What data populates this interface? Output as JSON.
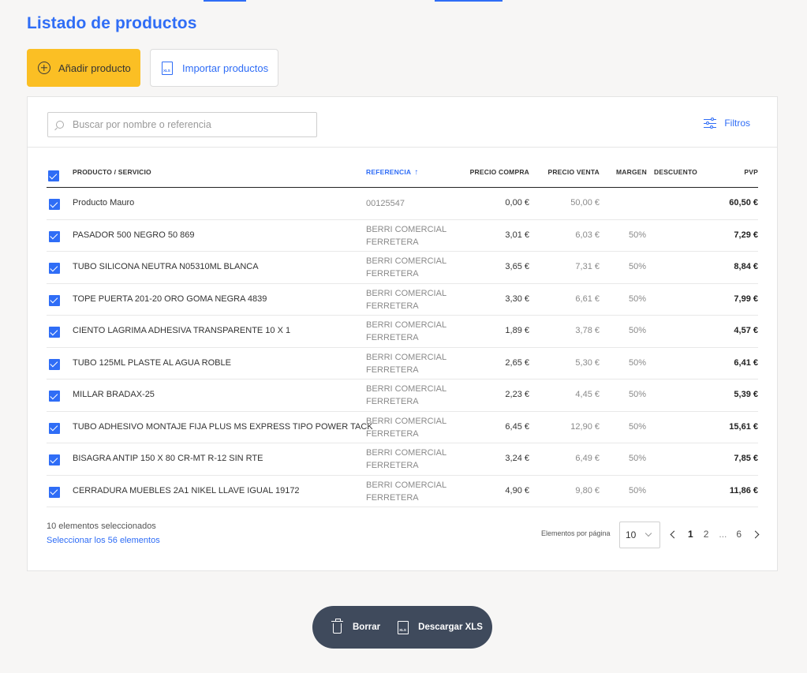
{
  "page": {
    "title": "Listado de productos",
    "accent_color": "#2f6df6"
  },
  "actions": {
    "add_label": "Añadir producto",
    "add_icon": "plus-circle-icon",
    "add_color": "#fbbf24",
    "import_label": "Importar productos",
    "import_icon": "xls-file-icon"
  },
  "search": {
    "placeholder": "Buscar por nombre o referencia",
    "value": "",
    "icon": "search-icon"
  },
  "filters": {
    "label": "Filtros",
    "icon": "sliders-icon"
  },
  "table": {
    "headers": {
      "product": "PRODUCTO / SERVICIO",
      "reference": "REFERENCIA",
      "buy_price": "PRECIO COMPRA",
      "sell_price": "PRECIO VENTA",
      "margin": "MARGEN",
      "discount": "DESCUENTO",
      "pvp": "PVP"
    },
    "sort": {
      "column": "reference",
      "direction": "ascending"
    },
    "all_checked": true,
    "rows": [
      {
        "checked": true,
        "name": "Producto Mauro",
        "ref": "00125547",
        "buy": "0,00 €",
        "sell": "50,00 €",
        "margin": "",
        "discount": "",
        "pvp": "60,50 €"
      },
      {
        "checked": true,
        "name": "PASADOR 500 NEGRO 50 869",
        "ref": "BERRI COMERCIAL FERRETERA",
        "buy": "3,01 €",
        "sell": "6,03 €",
        "margin": "50%",
        "discount": "",
        "pvp": "7,29 €"
      },
      {
        "checked": true,
        "name": "TUBO SILICONA NEUTRA N05310ML BLANCA",
        "ref": "BERRI COMERCIAL FERRETERA",
        "buy": "3,65 €",
        "sell": "7,31 €",
        "margin": "50%",
        "discount": "",
        "pvp": "8,84 €"
      },
      {
        "checked": true,
        "name": "TOPE PUERTA 201-20 ORO GOMA NEGRA 4839",
        "ref": "BERRI COMERCIAL FERRETERA",
        "buy": "3,30 €",
        "sell": "6,61 €",
        "margin": "50%",
        "discount": "",
        "pvp": "7,99 €"
      },
      {
        "checked": true,
        "name": "CIENTO LAGRIMA ADHESIVA TRANSPARENTE 10 X 1",
        "ref": "BERRI COMERCIAL FERRETERA",
        "buy": "1,89 €",
        "sell": "3,78 €",
        "margin": "50%",
        "discount": "",
        "pvp": "4,57 €"
      },
      {
        "checked": true,
        "name": "TUBO 125ML PLASTE AL AGUA ROBLE",
        "ref": "BERRI COMERCIAL FERRETERA",
        "buy": "2,65 €",
        "sell": "5,30 €",
        "margin": "50%",
        "discount": "",
        "pvp": "6,41 €"
      },
      {
        "checked": true,
        "name": "MILLAR BRADAX-25",
        "ref": "BERRI COMERCIAL FERRETERA",
        "buy": "2,23 €",
        "sell": "4,45 €",
        "margin": "50%",
        "discount": "",
        "pvp": "5,39 €"
      },
      {
        "checked": true,
        "name": "TUBO ADHESIVO MONTAJE FIJA PLUS MS EXPRESS TIPO POWER TACK",
        "ref": "BERRI COMERCIAL FERRETERA",
        "buy": "6,45 €",
        "sell": "12,90 €",
        "margin": "50%",
        "discount": "",
        "pvp": "15,61 €"
      },
      {
        "checked": true,
        "name": "BISAGRA ANTIP 150 X 80 CR-MT R-12 SIN RTE",
        "ref": "BERRI COMERCIAL FERRETERA",
        "buy": "3,24 €",
        "sell": "6,49 €",
        "margin": "50%",
        "discount": "",
        "pvp": "7,85 €"
      },
      {
        "checked": true,
        "name": "CERRADURA MUEBLES 2A1 NIKEL LLAVE IGUAL 19172",
        "ref": "BERRI COMERCIAL FERRETERA",
        "buy": "4,90 €",
        "sell": "9,80 €",
        "margin": "50%",
        "discount": "",
        "pvp": "11,86 €"
      }
    ]
  },
  "footer": {
    "selected_text": "10 elementos seleccionados",
    "select_all_text": "Seleccionar los 56 elementos",
    "per_page_label": "Elementos por página",
    "per_page_value": "10",
    "pages": [
      "1",
      "2",
      "...",
      "6"
    ],
    "current_page": "1"
  },
  "bulk_actions": {
    "delete_label": "Borrar",
    "delete_icon": "trash-icon",
    "download_label": "Descargar XLS",
    "download_icon": "xls-file-icon",
    "bar_color": "#3f4a5c"
  }
}
